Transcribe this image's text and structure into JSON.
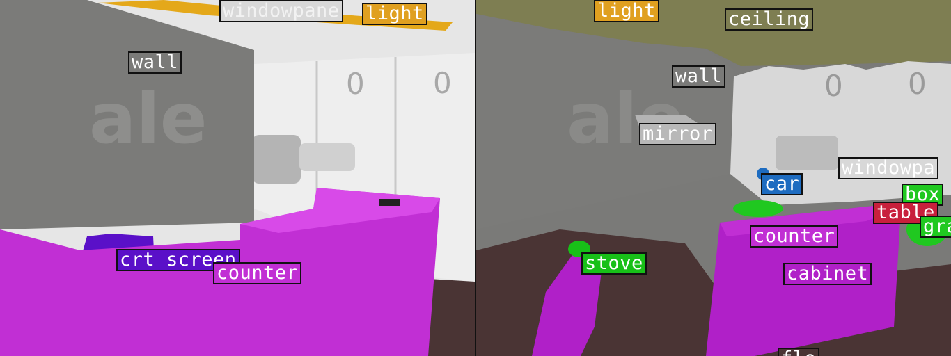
{
  "colors": {
    "light": "#e0a020",
    "wall": "#7a7a78",
    "windowpane": "#d8d8d8",
    "counter": "#c12fd4",
    "crt_screen": "#5a10c8",
    "ceiling": "#7e7e52",
    "mirror": "#b8b8b8",
    "car": "#1e6cc0",
    "table": "#c8203c",
    "box": "#20c820",
    "stove": "#18c018",
    "cabinet": "#b020c8",
    "floor": "#4a3434"
  },
  "left_panel": {
    "labels": {
      "windowpane": "windowpane",
      "light": "light",
      "wall": "wall",
      "crt_screen": "crt screen",
      "counter": "counter"
    }
  },
  "right_panel": {
    "labels": {
      "light": "light",
      "ceiling": "ceiling",
      "wall": "wall",
      "mirror": "mirror",
      "car": "car",
      "windowpane": "windowpa",
      "box": "box",
      "table": "table",
      "grass": "gra",
      "counter": "counter",
      "stove": "stove",
      "cabinet": "cabinet",
      "floor": "flo"
    }
  }
}
